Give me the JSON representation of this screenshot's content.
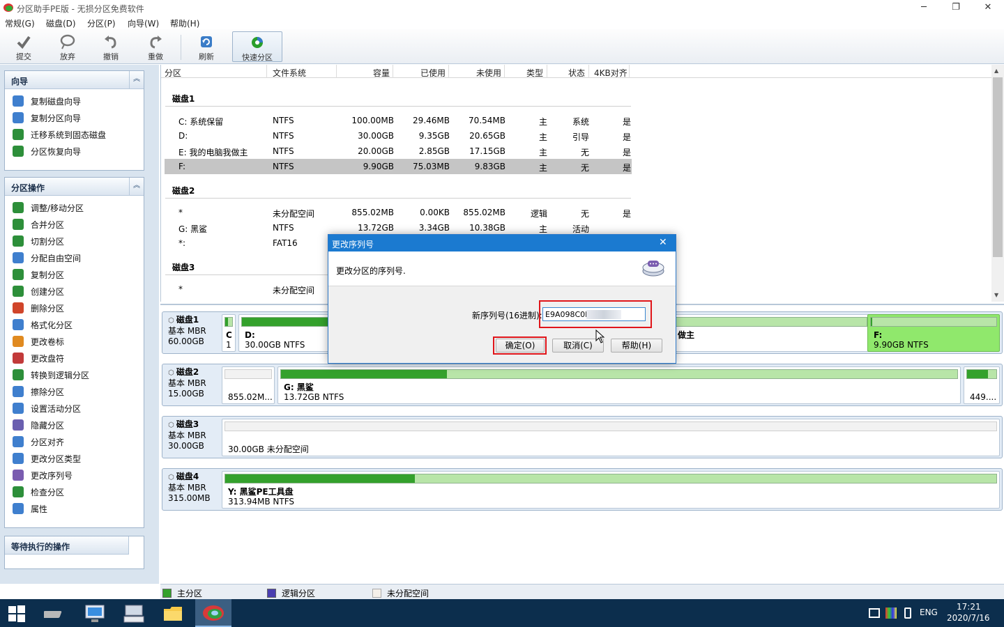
{
  "window": {
    "title": "分区助手PE版 - 无损分区免费软件",
    "minimize": "─",
    "restore": "❐",
    "close": "✕"
  },
  "menu": [
    "常规(G)",
    "磁盘(D)",
    "分区(P)",
    "向导(W)",
    "帮助(H)"
  ],
  "toolbar": {
    "commit": "提交",
    "discard": "放弃",
    "undo": "撤销",
    "redo": "重做",
    "refresh": "刷新",
    "quick": "快速分区"
  },
  "wizard_panel": {
    "title": "向导",
    "items": [
      "复制磁盘向导",
      "复制分区向导",
      "迁移系统到固态磁盘",
      "分区恢复向导"
    ]
  },
  "ops_panel": {
    "title": "分区操作",
    "items": [
      "调整/移动分区",
      "合并分区",
      "切割分区",
      "分配自由空间",
      "复制分区",
      "创建分区",
      "删除分区",
      "格式化分区",
      "更改卷标",
      "更改盘符",
      "转换到逻辑分区",
      "擦除分区",
      "设置活动分区",
      "隐藏分区",
      "分区对齐",
      "更改分区类型",
      "更改序列号",
      "检查分区",
      "属性"
    ]
  },
  "pending_panel": {
    "title": "等待执行的操作"
  },
  "table": {
    "headers": [
      "分区",
      "文件系统",
      "容量",
      "已使用",
      "未使用",
      "类型",
      "状态",
      "4KB对齐"
    ],
    "disks": [
      {
        "name": "磁盘1",
        "rows": [
          [
            "C: 系统保留",
            "NTFS",
            "100.00MB",
            "29.46MB",
            "70.54MB",
            "主",
            "系统",
            "是"
          ],
          [
            "D:",
            "NTFS",
            "30.00GB",
            "9.35GB",
            "20.65GB",
            "主",
            "引导",
            "是"
          ],
          [
            "E: 我的电脑我做主",
            "NTFS",
            "20.00GB",
            "2.85GB",
            "17.15GB",
            "主",
            "无",
            "是"
          ],
          [
            "F:",
            "NTFS",
            "9.90GB",
            "75.03MB",
            "9.83GB",
            "主",
            "无",
            "是"
          ]
        ]
      },
      {
        "name": "磁盘2",
        "rows": [
          [
            "*",
            "未分配空间",
            "855.02MB",
            "0.00KB",
            "855.02MB",
            "逻辑",
            "无",
            "是"
          ],
          [
            "G: 黑鲨",
            "NTFS",
            "13.72GB",
            "3.34GB",
            "10.38GB",
            "主",
            "活动",
            ""
          ],
          [
            "*:",
            "FAT16",
            "",
            "",
            "",
            "",
            "",
            ""
          ]
        ]
      },
      {
        "name": "磁盘3",
        "rows": [
          [
            "*",
            "未分配空间",
            "",
            "",
            "",
            "",
            "",
            ""
          ]
        ]
      }
    ]
  },
  "diskmap": {
    "disk1": {
      "name": "磁盘1",
      "type": "基本 MBR",
      "size": "60.00GB",
      "c_label": "C",
      "c_sub": "1",
      "d_label": "D:",
      "d_sub": "30.00GB NTFS",
      "e_label": "做主",
      "f_label": "F:",
      "f_sub": "9.90GB NTFS"
    },
    "disk2": {
      "name": "磁盘2",
      "type": "基本 MBR",
      "size": "15.00GB",
      "un_sub": "855.02M...",
      "g_label": "G: 黑鲨",
      "g_sub": "13.72GB NTFS",
      "last_sub": "449...."
    },
    "disk3": {
      "name": "磁盘3",
      "type": "基本 MBR",
      "size": "30.00GB",
      "sub": "30.00GB 未分配空间"
    },
    "disk4": {
      "name": "磁盘4",
      "type": "基本 MBR",
      "size": "315.00MB",
      "label": "Y: 黑鲨PE工具盘",
      "sub": "313.94MB NTFS"
    }
  },
  "legend": {
    "primary": "主分区",
    "logical": "逻辑分区",
    "unallocated": "未分配空间"
  },
  "dialog": {
    "title": "更改序列号",
    "close": "✕",
    "description": "更改分区的序列号.",
    "field_label": "新序列号(16进制):",
    "field_value": "E9A098C0E",
    "ok": "确定(O)",
    "cancel": "取消(C)",
    "help": "帮助(H)"
  },
  "taskbar": {
    "lang": "ENG",
    "time": "17:21",
    "date": "2020/7/16"
  }
}
